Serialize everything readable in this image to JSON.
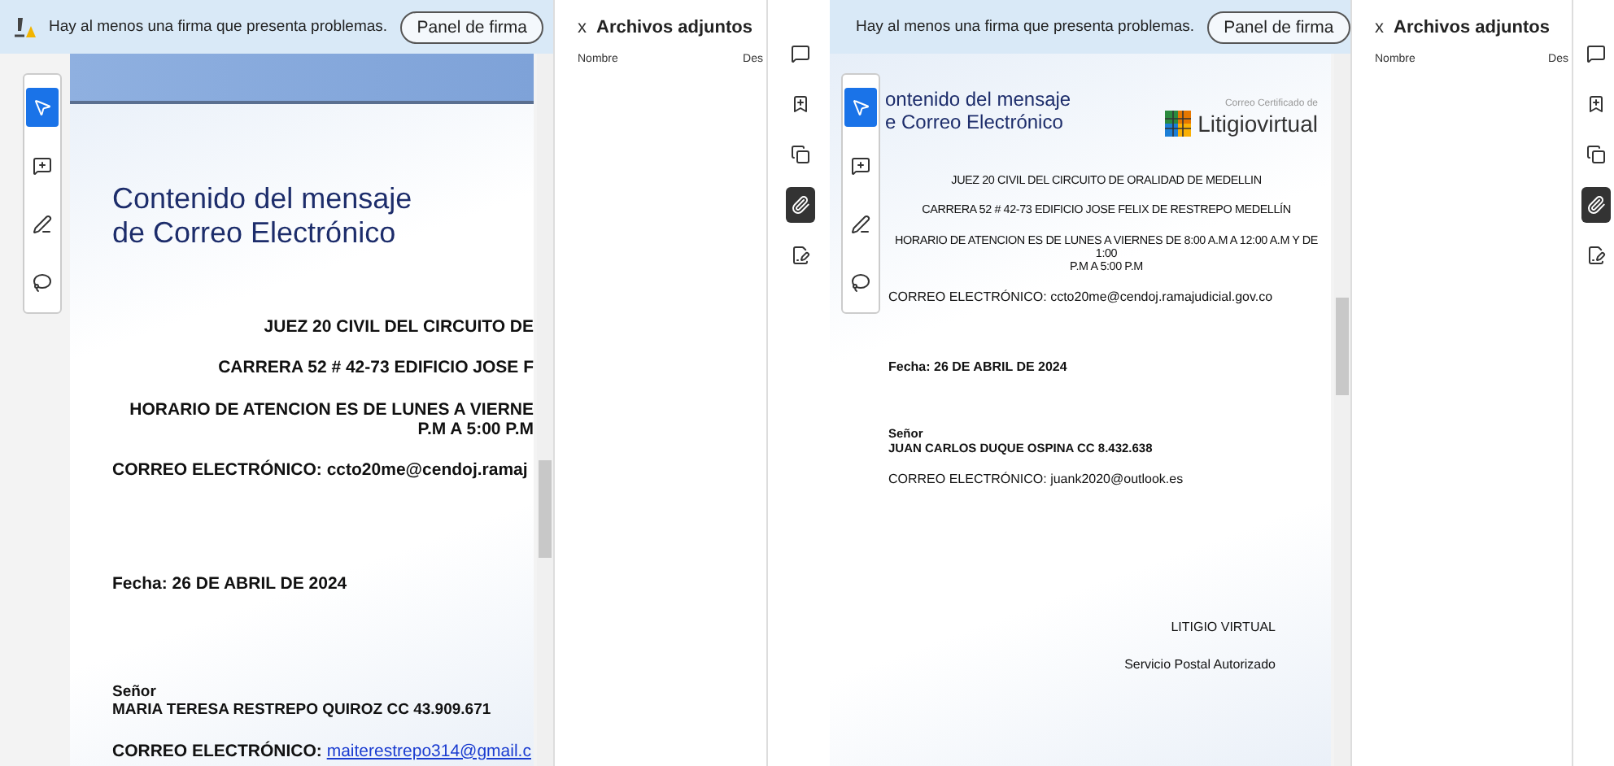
{
  "screens": [
    {
      "banner": {
        "message": "Hay al menos una firma que presenta problemas.",
        "button": "Panel de firma"
      },
      "tools": [
        {
          "kind": "select",
          "selected": true
        },
        {
          "kind": "comment",
          "selected": false
        },
        {
          "kind": "pen",
          "selected": false
        },
        {
          "kind": "lasso",
          "selected": false
        }
      ],
      "document": {
        "title_lines": [
          "Contenido del mensaje",
          "de Correo Electrónico"
        ],
        "lines": [
          {
            "kind": "center",
            "text": "JUEZ 20 CIVIL DEL CIRCUITO DE"
          },
          {
            "kind": "center",
            "text": "CARRERA 52 # 42-73 EDIFICIO JOSE F"
          },
          {
            "kind": "center",
            "text": "HORARIO DE ATENCION ES DE LUNES A VIERNE\nP.M A 5:00 P.M"
          },
          {
            "kind": "field",
            "label": "CORREO ELECTRÓNICO:",
            "value": "ccto20me@cendoj.ramaj",
            "link": false
          },
          {
            "kind": "date",
            "text": "Fecha: 26 DE ABRIL DE 2024"
          },
          {
            "kind": "name",
            "label": "Señor",
            "value": "MARIA TERESA RESTREPO QUIROZ CC 43.909.671"
          },
          {
            "kind": "field",
            "label": "CORREO ELECTRÓNICO:",
            "value": "maiterestrepo314@gmail.c",
            "link": true
          }
        ]
      },
      "attachments": {
        "close": "x",
        "title": "Archivos adjuntos",
        "columns": [
          "Nombre",
          "Des"
        ]
      },
      "rail": [
        {
          "kind": "comment",
          "selected": false
        },
        {
          "kind": "bookmark",
          "selected": false
        },
        {
          "kind": "pages",
          "selected": false
        },
        {
          "kind": "attachment",
          "selected": true
        },
        {
          "kind": "sign",
          "selected": false
        }
      ]
    },
    {
      "banner": {
        "message": "Hay al menos una firma que presenta problemas.",
        "button": "Panel de firma"
      },
      "tools": [
        {
          "kind": "select",
          "selected": true
        },
        {
          "kind": "comment",
          "selected": false
        },
        {
          "kind": "pen",
          "selected": false
        },
        {
          "kind": "lasso",
          "selected": false
        }
      ],
      "document": {
        "title_lines": [
          "ontenido del mensaje",
          "e Correo Electrónico"
        ],
        "logo": {
          "caption": "Correo Certificado de",
          "name": "Litigiovirtual"
        },
        "lines": [
          {
            "kind": "center",
            "text": "JUEZ 20 CIVIL DEL CIRCUITO DE ORALIDAD DE MEDELLIN"
          },
          {
            "kind": "center",
            "text": "CARRERA 52 # 42-73 EDIFICIO JOSE FELIX DE RESTREPO MEDELLÍN"
          },
          {
            "kind": "center",
            "text": "HORARIO DE ATENCION ES DE LUNES A VIERNES DE 8:00 A.M A 12:00 A.M Y DE 1:00\nP.M A 5:00 P.M"
          },
          {
            "kind": "field",
            "label": "CORREO ELECTRÓNICO:",
            "value": "ccto20me@cendoj.ramajudicial.gov.co",
            "link": false
          },
          {
            "kind": "date",
            "text": "Fecha: 26 DE ABRIL DE 2024"
          },
          {
            "kind": "name",
            "label": "Señor",
            "value": "JUAN CARLOS DUQUE OSPINA CC 8.432.638"
          },
          {
            "kind": "field",
            "label": "CORREO ELECTRÓNICO:",
            "value": "juank2020@outlook.es",
            "link": false
          },
          {
            "kind": "footer",
            "text": "LITIGIO VIRTUAL"
          },
          {
            "kind": "footer",
            "text": "Servicio Postal Autorizado"
          }
        ]
      },
      "attachments": {
        "close": "x",
        "title": "Archivos adjuntos",
        "columns": [
          "Nombre",
          "Des"
        ]
      },
      "rail": [
        {
          "kind": "comment",
          "selected": false
        },
        {
          "kind": "bookmark",
          "selected": false
        },
        {
          "kind": "pages",
          "selected": false
        },
        {
          "kind": "attachment",
          "selected": true
        },
        {
          "kind": "sign",
          "selected": false
        }
      ]
    }
  ]
}
